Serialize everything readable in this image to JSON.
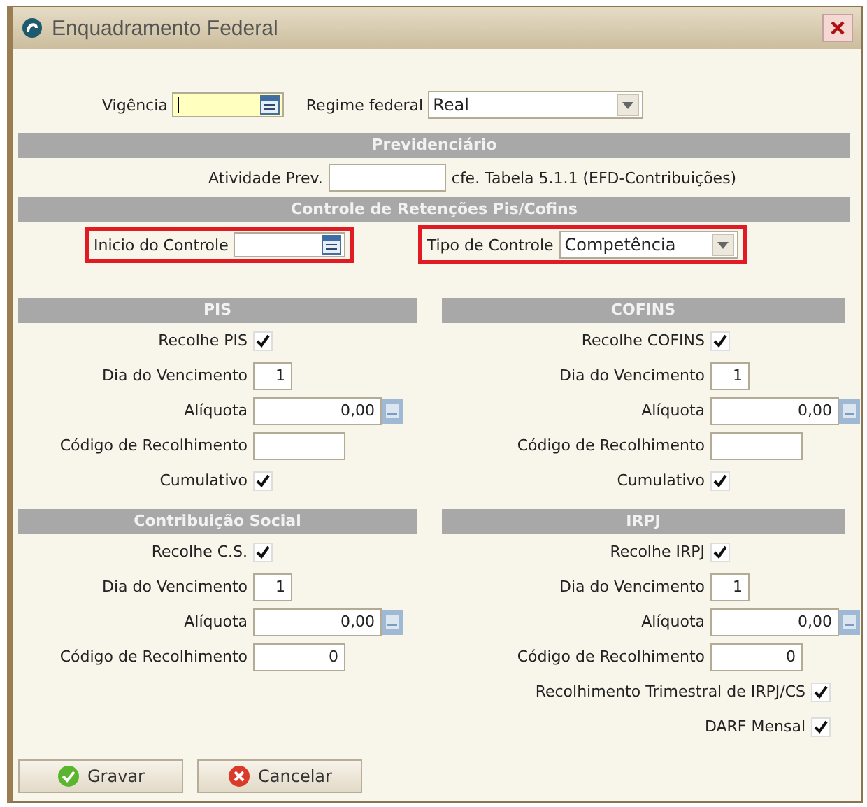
{
  "window": {
    "title": "Enquadramento Federal"
  },
  "top": {
    "vigencia": {
      "label": "Vigência",
      "focused": true
    },
    "regime": {
      "label": "Regime federal",
      "value": "Real"
    }
  },
  "previdenciario": {
    "title": "Previdenciário",
    "label": "Atividade Prev.",
    "note": "cfe. Tabela 5.1.1 (EFD-Contribuições)"
  },
  "retencoes": {
    "title": "Controle de Retenções Pis/Cofins",
    "inicio": {
      "label": "Inicio do Controle"
    },
    "tipo": {
      "label": "Tipo de Controle",
      "value": "Competência"
    }
  },
  "sections": [
    {
      "title": "PIS",
      "rows": [
        {
          "kind": "check",
          "label": "Recolhe PIS",
          "checked": true
        },
        {
          "kind": "day",
          "label": "Dia do Vencimento",
          "value": "1"
        },
        {
          "kind": "decimal",
          "label": "Alíquota",
          "value": "0,00"
        },
        {
          "kind": "code",
          "label": "Código de Recolhimento"
        },
        {
          "kind": "check",
          "label": "Cumulativo",
          "checked": true
        }
      ]
    },
    {
      "title": "COFINS",
      "rows": [
        {
          "kind": "check",
          "label": "Recolhe COFINS",
          "checked": true
        },
        {
          "kind": "day",
          "label": "Dia do Vencimento",
          "value": "1"
        },
        {
          "kind": "decimal",
          "label": "Alíquota",
          "value": "0,00"
        },
        {
          "kind": "code",
          "label": "Código de Recolhimento"
        },
        {
          "kind": "check",
          "label": "Cumulativo",
          "checked": true
        }
      ]
    },
    {
      "title": "Contribuição Social",
      "rows": [
        {
          "kind": "check",
          "label": "Recolhe C.S.",
          "checked": true
        },
        {
          "kind": "day",
          "label": "Dia do Vencimento",
          "value": "1"
        },
        {
          "kind": "decimal",
          "label": "Alíquota",
          "value": "0,00"
        },
        {
          "kind": "code",
          "label": "Código de Recolhimento",
          "value": "0"
        }
      ]
    },
    {
      "title": "IRPJ",
      "rows": [
        {
          "kind": "check",
          "label": "Recolhe IRPJ",
          "checked": true
        },
        {
          "kind": "day",
          "label": "Dia do Vencimento",
          "value": "1"
        },
        {
          "kind": "decimal",
          "label": "Alíquota",
          "value": "0,00"
        },
        {
          "kind": "code",
          "label": "Código de Recolhimento",
          "value": "0"
        },
        {
          "kind": "option",
          "label": "Recolhimento Trimestral de IRPJ/CS",
          "checked": true
        },
        {
          "kind": "option",
          "label": "DARF Mensal",
          "checked": true
        }
      ]
    }
  ],
  "buttons": [
    {
      "label": "Gravar",
      "kind": "ok"
    },
    {
      "label": "Cancelar",
      "kind": "cancel"
    }
  ]
}
